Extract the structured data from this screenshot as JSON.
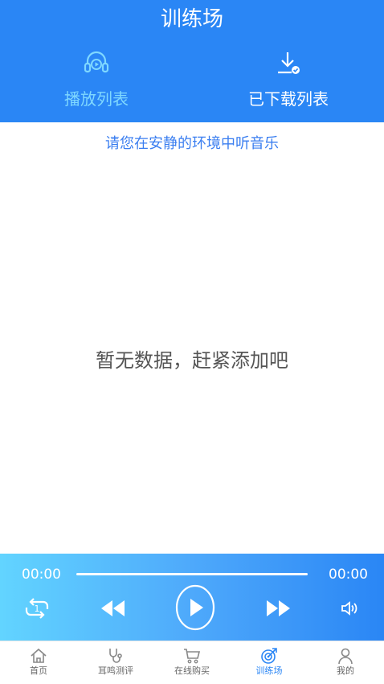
{
  "header": {
    "title": "训练场",
    "tabs": [
      {
        "label": "播放列表",
        "icon": "headphones-play-icon",
        "active": true
      },
      {
        "label": "已下载列表",
        "icon": "download-check-icon",
        "active": false
      }
    ]
  },
  "main": {
    "hint": "请您在安静的环境中听音乐",
    "empty_text": "暂无数据，赶紧添加吧"
  },
  "player": {
    "current_time": "00:00",
    "total_time": "00:00",
    "progress": 0,
    "repeat_badge": "1",
    "controls": [
      "repeat-one-icon",
      "rewind-icon",
      "play-icon",
      "fast-forward-icon",
      "volume-icon"
    ]
  },
  "nav": {
    "items": [
      {
        "label": "首页",
        "icon": "home-icon"
      },
      {
        "label": "耳鸣测评",
        "icon": "stethoscope-icon"
      },
      {
        "label": "在线购买",
        "icon": "cart-icon"
      },
      {
        "label": "训练场",
        "icon": "target-icon",
        "active": true
      },
      {
        "label": "我的",
        "icon": "user-icon"
      }
    ]
  },
  "colors": {
    "primary": "#2a86f5",
    "active_tab": "#7fd8ff",
    "hint": "#3a7ef0",
    "player_start": "#62d4ff",
    "player_end": "#2a86f5"
  }
}
